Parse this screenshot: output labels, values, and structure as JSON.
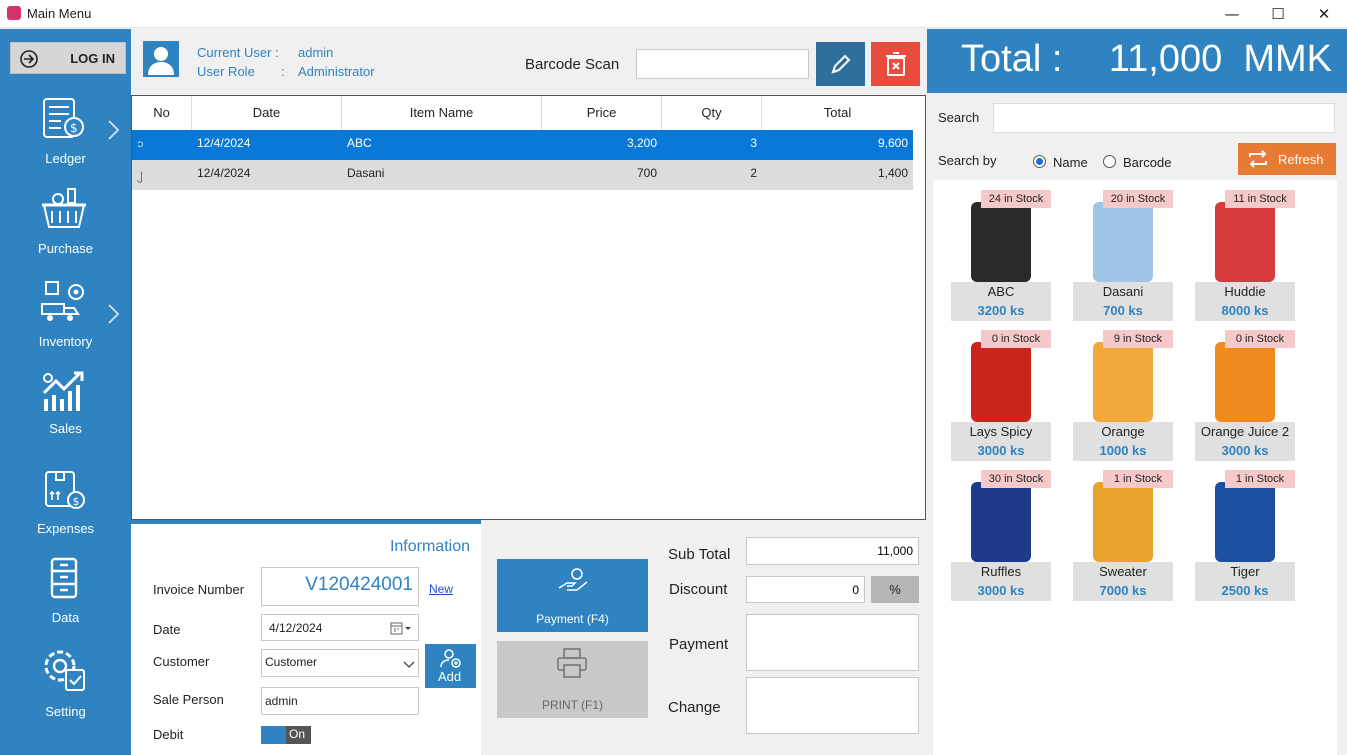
{
  "window": {
    "title": "Main Menu",
    "minimize": "—",
    "maximize": "☐",
    "close": "✕"
  },
  "sidebar": {
    "login_label": "LOG IN",
    "items": [
      {
        "label": "Ledger",
        "icon": "ledger-icon",
        "has_submenu": true
      },
      {
        "label": "Purchase",
        "icon": "basket-icon",
        "has_submenu": false
      },
      {
        "label": "Inventory",
        "icon": "inventory-icon",
        "has_submenu": true
      },
      {
        "label": "Sales",
        "icon": "sales-chart-icon",
        "has_submenu": false
      },
      {
        "label": "Expenses",
        "icon": "expenses-icon",
        "has_submenu": false
      },
      {
        "label": "Data",
        "icon": "data-cabinet-icon",
        "has_submenu": false
      },
      {
        "label": "Setting",
        "icon": "gear-icon",
        "has_submenu": false
      }
    ]
  },
  "header": {
    "current_user_label": "Current User :",
    "current_user": "admin",
    "user_role_label": "User Role",
    "user_role_sep": ":",
    "user_role": "Administrator",
    "barcode_label": "Barcode Scan",
    "barcode_value": ""
  },
  "table": {
    "columns": [
      "No",
      "Date",
      "Item Name",
      "Price",
      "Qty",
      "Total"
    ],
    "rows": [
      {
        "no": "၁",
        "date": "12/4/2024",
        "item": "ABC",
        "price": "3,200",
        "qty": "3",
        "total": "9,600",
        "selected": true
      },
      {
        "no": "၂",
        "date": "12/4/2024",
        "item": "Dasani",
        "price": "700",
        "qty": "2",
        "total": "1,400",
        "selected": false
      }
    ]
  },
  "total": {
    "label": "Total :",
    "value": "11,000  MMK"
  },
  "search": {
    "label": "Search",
    "value": "",
    "by_label": "Search by",
    "options": [
      "Name",
      "Barcode"
    ],
    "selected": "Name",
    "refresh_label": "Refresh"
  },
  "products": [
    {
      "name": "ABC",
      "price": "3200 ks",
      "stock": "24 in Stock",
      "color": "#2a2a2a"
    },
    {
      "name": "Dasani",
      "price": "700 ks",
      "stock": "20 in Stock",
      "color": "#9fc4e8"
    },
    {
      "name": "Huddie",
      "price": "8000 ks",
      "stock": "11 in Stock",
      "color": "#d63a3a"
    },
    {
      "name": "Lays Spicy",
      "price": "3000 ks",
      "stock": "0 in Stock",
      "color": "#c8261c"
    },
    {
      "name": "Orange",
      "price": "1000 ks",
      "stock": "9 in Stock",
      "color": "#f2a93b"
    },
    {
      "name": "Orange Juice 2",
      "price": "3000 ks",
      "stock": "0 in Stock",
      "color": "#f08a1c"
    },
    {
      "name": "Ruffles",
      "price": "3000 ks",
      "stock": "30 in Stock",
      "color": "#1f3a8a"
    },
    {
      "name": "Sweater",
      "price": "7000 ks",
      "stock": "1 in Stock",
      "color": "#e8a42a"
    },
    {
      "name": "Tiger",
      "price": "2500 ks",
      "stock": "1 in Stock",
      "color": "#1c4fa0"
    }
  ],
  "info": {
    "title": "Information",
    "invoice_label": "Invoice Number",
    "invoice_number": "V120424001",
    "new_link": "New",
    "date_label": "Date",
    "date_value": "4/12/2024",
    "customer_label": "Customer",
    "customer_value": "Customer",
    "add_label": "Add",
    "sale_person_label": "Sale Person",
    "sale_person_value": "admin",
    "debit_label": "Debit",
    "debit_toggle": "On"
  },
  "payment": {
    "pay_button": "Payment (F4)",
    "print_button": "PRINT (F1)",
    "subtotal_label": "Sub Total",
    "subtotal_value": "11,000",
    "discount_label": "Discount",
    "discount_value": "0",
    "percent_label": "%",
    "payment_label": "Payment",
    "payment_value": "",
    "change_label": "Change",
    "change_value": ""
  }
}
